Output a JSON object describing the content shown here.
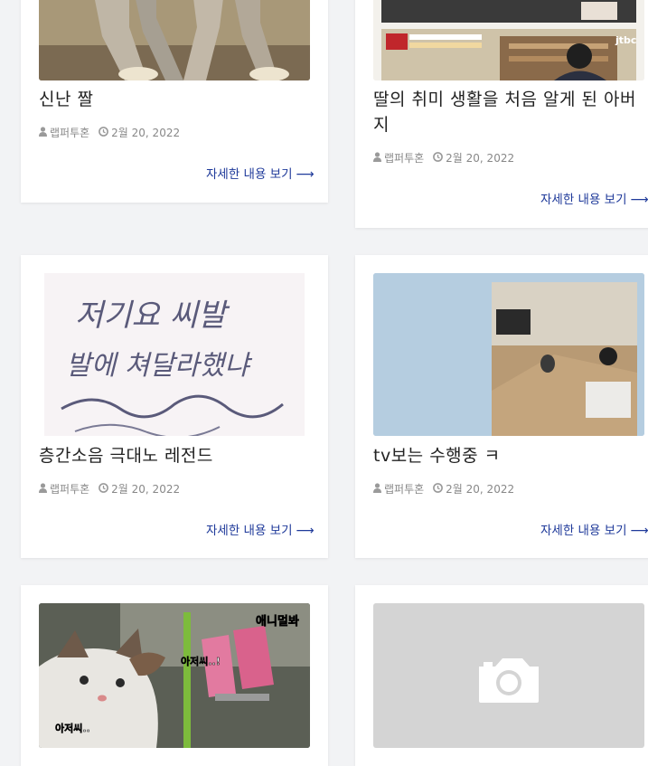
{
  "posts": [
    {
      "title": "신난 짤",
      "author": "랩퍼투혼",
      "date": "2월 20, 2022",
      "more": "자세한 내용 보기"
    },
    {
      "title": "딸의 취미 생활을 처음 알게 된 아버지",
      "author": "랩퍼투혼",
      "date": "2월 20, 2022",
      "more": "자세한 내용 보기"
    },
    {
      "title": "층간소음 극대노 레전드",
      "author": "랩퍼투혼",
      "date": "2월 20, 2022",
      "more": "자세한 내용 보기",
      "image_text": [
        "저기요 씨발",
        "발에 쳐달라했냐"
      ]
    },
    {
      "title": "tv보는 수행중 ㅋ",
      "author": "랩퍼투혼",
      "date": "2월 20, 2022",
      "more": "자세한 내용 보기"
    },
    {
      "image_text": [
        "애니멀봐",
        "아저씨..!",
        "아저씨.."
      ]
    },
    {
      "image_placeholder": "camera-icon"
    }
  ],
  "image_overlays": {
    "tv_logo": "jtbc"
  },
  "colors": {
    "link": "#1f3a9a",
    "meta": "#888888",
    "background": "#f2f3f5",
    "placeholder": "#d4d4d4"
  },
  "icons": {
    "author": "user-icon",
    "date": "clock-icon",
    "more": "arrow-right-icon"
  }
}
